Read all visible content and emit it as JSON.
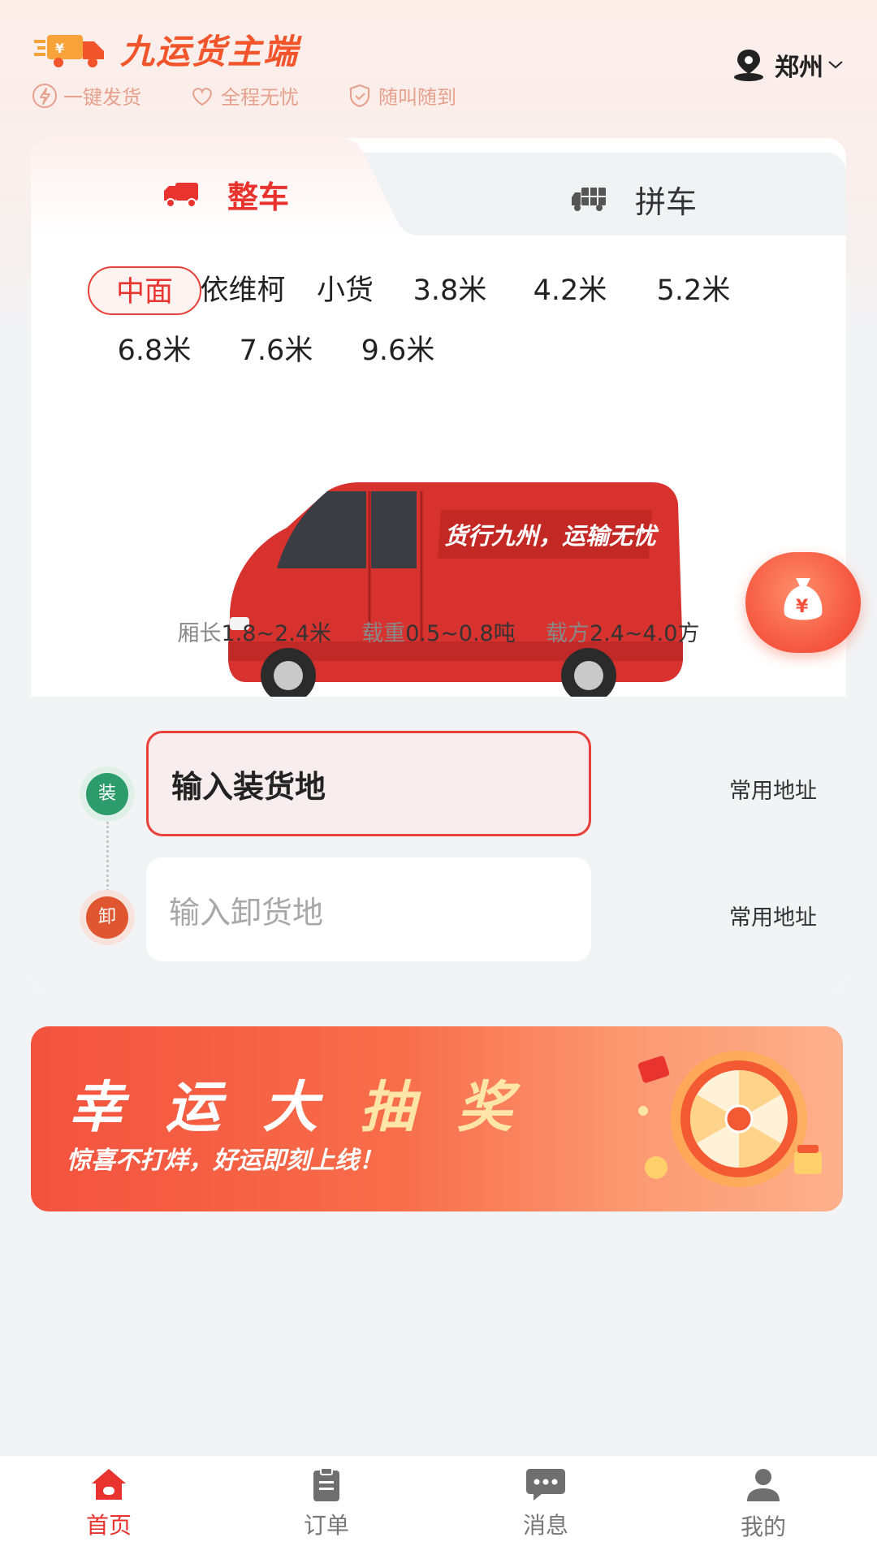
{
  "header": {
    "app_name": "九运货主端",
    "features": [
      "一键发货",
      "全程无忧",
      "随叫随到"
    ],
    "city": "郑州"
  },
  "tabs": {
    "whole_truck": "整车",
    "shared_truck": "拼车",
    "active": "整车"
  },
  "vehicle_types": [
    "中面",
    "依维柯",
    "小货",
    "3.8米",
    "4.2米",
    "5.2米",
    "6.8米",
    "7.6米",
    "9.6米"
  ],
  "selected_vehicle": "中面",
  "vehicle": {
    "slogan": "货行九州，运输无忧",
    "length_label": "厢长",
    "length_value": "1.8~2.4米",
    "weight_label": "载重",
    "weight_value": "0.5~0.8吨",
    "volume_label": "载方",
    "volume_value": "2.4~4.0方"
  },
  "address": {
    "load_tag": "装",
    "load_placeholder": "输入装货地",
    "unload_tag": "卸",
    "unload_placeholder": "输入卸货地",
    "common_label": "常用地址"
  },
  "banner": {
    "title_part1": "幸 运 大 ",
    "title_part2": "抽 奖",
    "subtitle": "惊喜不打烊，好运即刻上线！"
  },
  "bottom_nav": [
    {
      "label": "首页",
      "icon": "home-icon",
      "active": true
    },
    {
      "label": "订单",
      "icon": "clipboard-icon",
      "active": false
    },
    {
      "label": "消息",
      "icon": "chat-icon",
      "active": false
    },
    {
      "label": "我的",
      "icon": "user-icon",
      "active": false
    }
  ],
  "colors": {
    "brand": "#e8332f",
    "load_green": "#2d9c6d",
    "unload_orange": "#e05630"
  }
}
